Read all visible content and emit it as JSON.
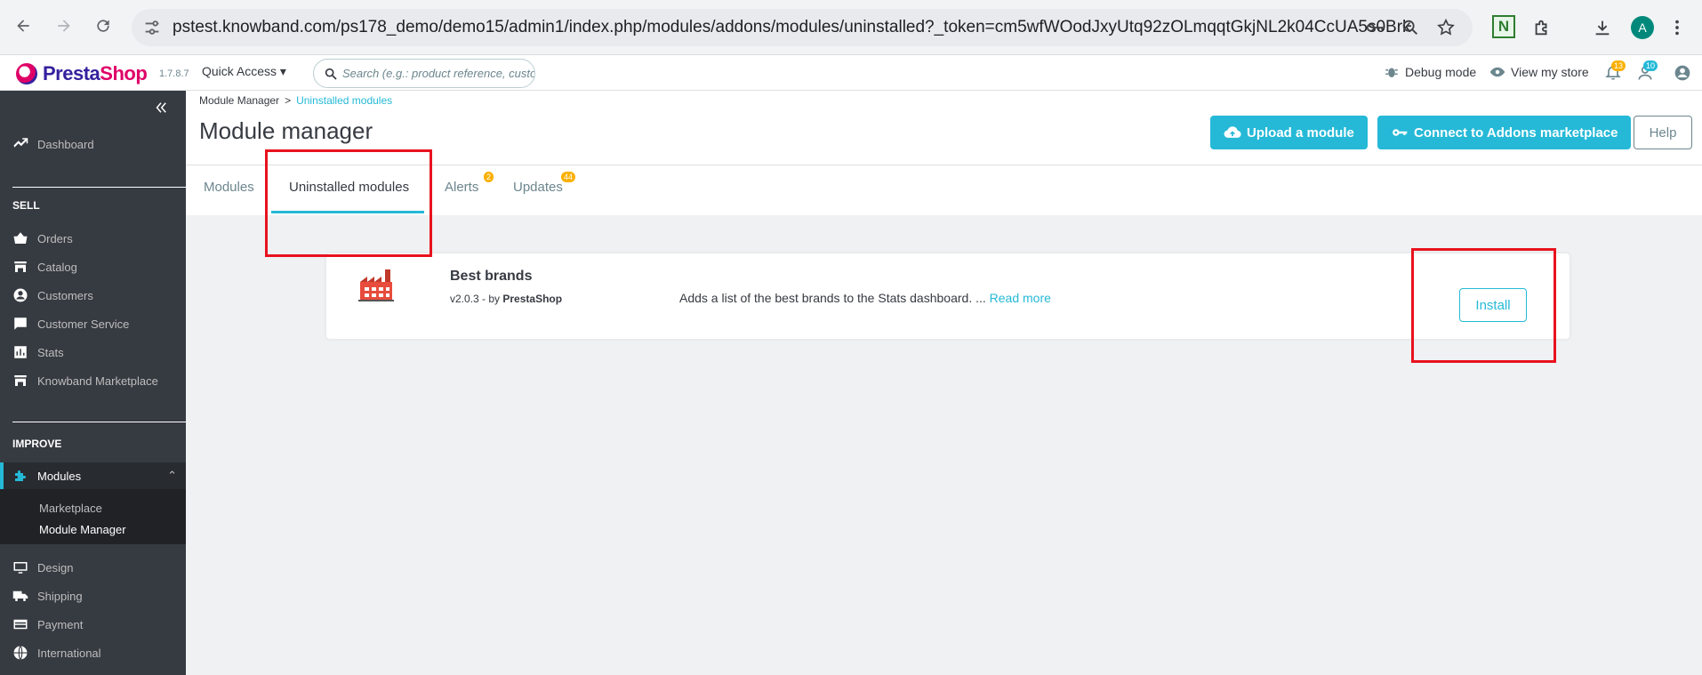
{
  "browser": {
    "url_host": "pstest.knowband.com",
    "url_path": "/ps178_demo/demo15/admin1/index.php/modules/addons/modules/uninstalled?_token=cm5wfWOodJxyUtq92zOLmqqtGkjNL2k04CcUA5s0Brk",
    "extension_label": "N",
    "profile_initial": "A"
  },
  "header": {
    "logo_presta": "Presta",
    "logo_shop": "Shop",
    "version": "1.7.8.7",
    "quick_access": "Quick Access",
    "search_placeholder": "Search (e.g.: product reference, custon",
    "debug_mode": "Debug mode",
    "view_store": "View my store",
    "orders_badge": "13",
    "customers_badge": "10"
  },
  "sidebar": {
    "dashboard": "Dashboard",
    "sell": "SELL",
    "orders": "Orders",
    "catalog": "Catalog",
    "customers": "Customers",
    "customer_service": "Customer Service",
    "stats": "Stats",
    "knowband": "Knowband Marketplace",
    "improve": "IMPROVE",
    "modules": "Modules",
    "marketplace": "Marketplace",
    "module_manager": "Module Manager",
    "design": "Design",
    "shipping": "Shipping",
    "payment": "Payment",
    "international": "International"
  },
  "page": {
    "breadcrumb_root": "Module Manager",
    "breadcrumb_sep": ">",
    "breadcrumb_current": "Uninstalled modules",
    "title": "Module manager",
    "upload_btn": "Upload a module",
    "connect_btn": "Connect to Addons marketplace",
    "help_btn": "Help"
  },
  "tabs": {
    "modules": "Modules",
    "uninstalled": "Uninstalled modules",
    "alerts": "Alerts",
    "alerts_badge": "2",
    "updates": "Updates",
    "updates_badge": "44"
  },
  "module": {
    "name": "Best brands",
    "version": "v2.0.3 - by",
    "author": "PrestaShop",
    "description": "Adds a list of the best brands to the Stats dashboard. ...",
    "read_more": "Read more",
    "install": "Install"
  },
  "colors": {
    "accent": "#25b9d7",
    "sidebar": "#363a41",
    "highlight_box": "#e8121e"
  }
}
